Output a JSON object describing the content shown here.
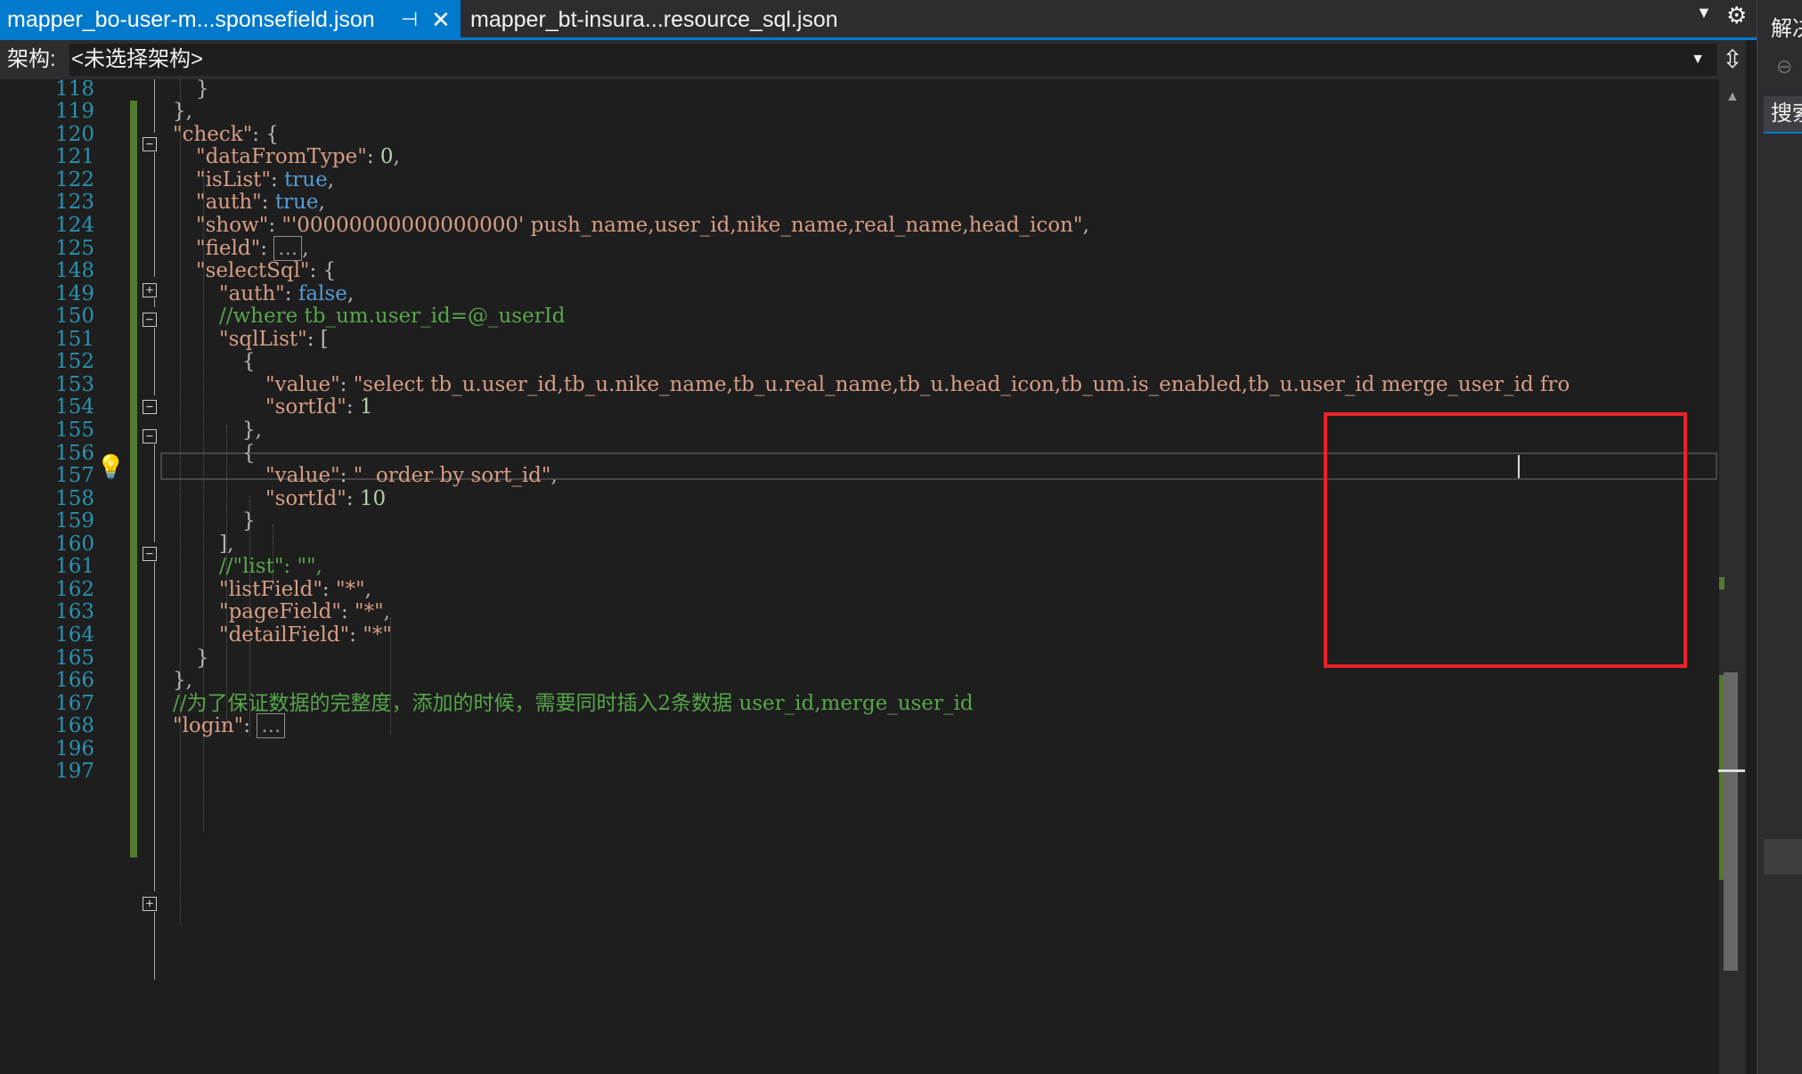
{
  "tabs": {
    "active_label": "mapper_bo-user-m...sponsefield.json",
    "pin_glyph": "⊣",
    "close_glyph": "✕",
    "inactive_label": "mapper_bt-insura...resource_sql.json",
    "dropdown_glyph": "▼",
    "gear_glyph": "⚙"
  },
  "navbar": {
    "label": "架构:",
    "value": "<未选择架构>",
    "arrow_glyph": "▼",
    "split_glyph": "⇳"
  },
  "right_panel": {
    "title": "解决",
    "back_glyph": "⊖",
    "search_label": "搜索"
  },
  "editor": {
    "line_numbers": [
      "118",
      "119",
      "120",
      "121",
      "122",
      "123",
      "124",
      "125",
      "148",
      "149",
      "150",
      "151",
      "152",
      "153",
      "154",
      "155",
      "156",
      "157",
      "158",
      "159",
      "160",
      "161",
      "162",
      "163",
      "164",
      "165",
      "166",
      "167",
      "168",
      "196",
      "197"
    ],
    "code": {
      "l118": "}",
      "l119": "},",
      "l120_key": "\"check\"",
      "l120_rest": ": {",
      "l121_key": "\"dataFromType\"",
      "l121_p": ": ",
      "l121_val": "0",
      "l121_end": ",",
      "l122_key": "\"isList\"",
      "l122_p": ": ",
      "l122_val": "true",
      "l122_end": ",",
      "l123_key": "\"auth\"",
      "l123_p": ": ",
      "l123_val": "true",
      "l123_end": ",",
      "l124_key": "\"show\"",
      "l124_p": ": ",
      "l124_val": "\"'00000000000000000' push_name,user_id,nike_name,real_name,head_icon\"",
      "l124_end": ",",
      "l125_key": "\"field\"",
      "l125_p": ": ",
      "l125_collapsed": "...",
      "l125_end": ",",
      "l148_key": "\"selectSql\"",
      "l148_rest": ": {",
      "l149_key": "\"auth\"",
      "l149_p": ": ",
      "l149_val": "false",
      "l149_end": ",",
      "l150_comment": "//where tb_um.user_id=@_userId",
      "l151_key": "\"sqlList\"",
      "l151_rest": ": [",
      "l152": "{",
      "l153_key": "\"value\"",
      "l153_p": ": ",
      "l153_val": "\"select tb_u.user_id,tb_u.nike_name,tb_u.real_name,tb_u.head_icon,tb_um.is_enabled,tb_u.user_id merge_user_id fro",
      "l154_key": "\"sortId\"",
      "l154_p": ": ",
      "l154_val": "1",
      "l155": "},",
      "l156": "{",
      "l157_key": "\"value\"",
      "l157_p": ": ",
      "l157_val": "\"  order by sort_id\"",
      "l157_end": ",",
      "l158_key": "\"sortId\"",
      "l158_p": ": ",
      "l158_val": "10",
      "l159": "}",
      "l160": "],",
      "l161_comment": "//\"list\": \"\",",
      "l162_key": "\"listField\"",
      "l162_p": ": ",
      "l162_val": "\"*\"",
      "l162_end": ",",
      "l163_key": "\"pageField\"",
      "l163_p": ": ",
      "l163_val": "\"*\"",
      "l163_end": ",",
      "l164_key": "\"detailField\"",
      "l164_p": ": ",
      "l164_val": "\"*\"",
      "l165": "}",
      "l166": "},",
      "l167_comment": "//为了保证数据的完整度，添加的时候，需要同时插入2条数据 user_id,merge_user_id",
      "l168_key": "\"login\"",
      "l168_p": ": ",
      "l168_collapsed": "..."
    },
    "fold_expanded_glyph": "−",
    "fold_collapsed_glyph": "+",
    "lightbulb_glyph": "💡"
  },
  "scrollbar": {
    "up_glyph": "▲"
  },
  "colors": {
    "accent": "#007acc",
    "editor_bg": "#1e1e1e",
    "string": "#d69d85",
    "keyword": "#569cd6",
    "comment": "#57a64a",
    "line_number": "#2b91af",
    "highlight_box": "#e8222a",
    "change_bar": "#537b2f"
  }
}
